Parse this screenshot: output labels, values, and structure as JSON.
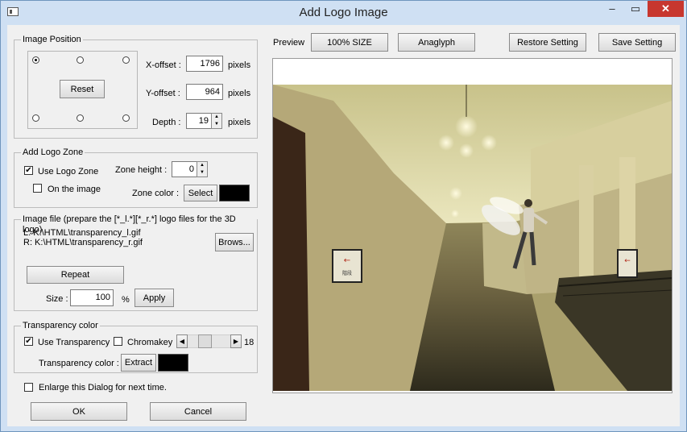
{
  "window": {
    "title": "Add Logo Image"
  },
  "image_position": {
    "title": "Image Position",
    "reset": "Reset",
    "x_label": "X-offset :",
    "x_value": "1796",
    "y_label": "Y-offset :",
    "y_value": "964",
    "depth_label": "Depth :",
    "depth_value": "19",
    "unit": "pixels"
  },
  "logo_zone": {
    "title": "Add Logo Zone",
    "use_logo_zone": "Use Logo Zone",
    "on_image": "On the image",
    "zone_height_label": "Zone height :",
    "zone_height_value": "0",
    "zone_color_label": "Zone color :",
    "select": "Select"
  },
  "image_file": {
    "title": "Image file (prepare the [*_l.*][*_r.*] logo files for the 3D logo)",
    "left": "L: K:\\HTML\\transparency_l.gif",
    "right": "R: K:\\HTML\\transparency_r.gif",
    "browse": "Brows...",
    "repeat": "Repeat",
    "size_label": "Size :",
    "size_value": "100",
    "percent": "%",
    "apply": "Apply"
  },
  "transparency": {
    "title": "Transparency color",
    "use_transparency": "Use Transparency",
    "chromakey": "Chromakey",
    "slider_value": "18",
    "color_label": "Transparency color :",
    "extract": "Extract"
  },
  "enlarge": "Enlarge this Dialog for next time.",
  "ok": "OK",
  "cancel": "Cancel",
  "preview": {
    "label": "Preview",
    "size100": "100% SIZE",
    "anaglyph": "Anaglyph",
    "restore": "Restore Setting",
    "save": "Save Setting",
    "sign_text": "階段"
  }
}
